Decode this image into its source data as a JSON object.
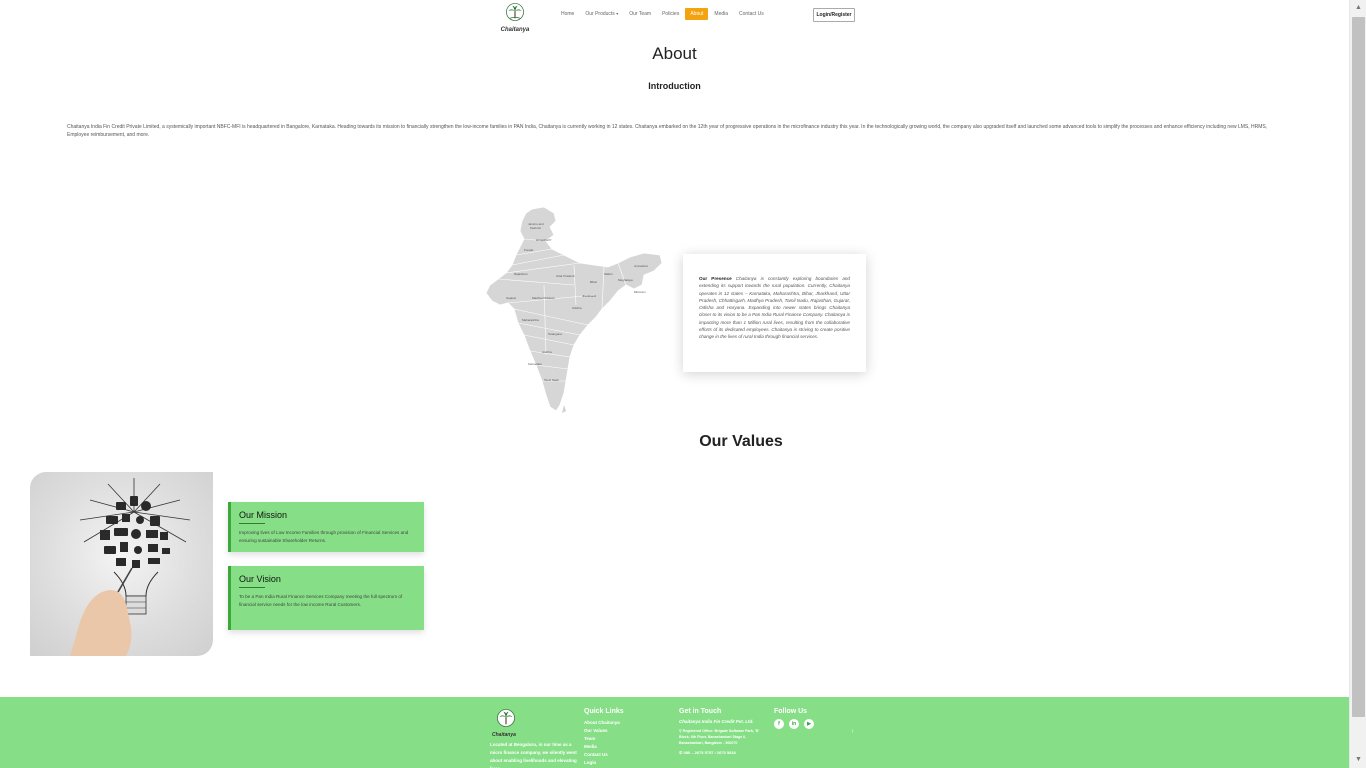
{
  "header": {
    "logo_text": "Chaitanya",
    "nav": [
      {
        "label": "Home"
      },
      {
        "label": "Our Products"
      },
      {
        "label": "Our Team"
      },
      {
        "label": "Policies"
      },
      {
        "label": "About"
      },
      {
        "label": "Media"
      },
      {
        "label": "Contact Us"
      }
    ],
    "active_nav": "About",
    "login_label": "Login/Register"
  },
  "about": {
    "title": "About",
    "intro_heading": "Introduction",
    "intro_text": "Chaitanya India Fin Credit Private Limited, a systemically important NBFC-MFI is headquartered in Bangalore, Karnataka. Heading towards its mission to financially strengthen the low-income families in PAN India, Chaitanya is currently working in 12 states. Chaitanya embarked on the 12th year of progressive operations in the microfinance industry this year. In the technologically growing world, the company also upgraded itself and launched some advanced tools to simplify the processes and enhance efficiency including new LMS, HRMS, Employee reimbursement, and more."
  },
  "presence": {
    "heading": "Our Presence",
    "text": "Chaitanya is constantly exploring boundaries and extending its support towards the rural population. Currently, Chaitanya operates in 12 states – Karnataka, Maharashtra, Bihar, Jharkhand, Uttar Pradesh, Chhattisgarh, Madhya Pradesh, Tamil Nadu, Rajasthan, Gujarat, Odisha and Haryana. Expanding into newer states brings Chaitanya closer to its vision to be a Pan India Rural Finance Company. Chaitanya is impacting more than 1 Million rural lives, resulting from the collaborative efforts of its dedicated employees. Chaitanya is striving to create positive change in the lives of rural India through financial services."
  },
  "values": {
    "title": "Our Values",
    "mission_title": "Our Mission",
    "mission_text": "Improving lives of Low Income Families through provision of Financial Services and ensuring sustainable Shareholder Returns.",
    "vision_title": "Our Vision",
    "vision_text": "To be a Pan India Rural Finance Services Company meeting the full spectrum of financial service needs for the low income Rural Customers."
  },
  "footer": {
    "logo_text": "Chaitanya",
    "about_text": "Located at Bengaluru, in our time as a micro finance company, we silently went about enabling livelihoods and elevating lives.",
    "quick_links_title": "Quick Links",
    "quick_links": [
      "About Chaitanya",
      "Our Values",
      "Team",
      "Media",
      "Contact Us",
      "Login"
    ],
    "get_in_touch_title": "Get in Touch",
    "company_name": "Chaitanya India Fin Credit Pvt. Ltd.",
    "address": "Registered Office: Brigade Software Park, 'B' Block, 6th Floor, Banashankari Stage II, Banashankari, Bangalore - 560070",
    "phone": "080 – 2675 5757 / 2675 5818",
    "follow_us_title": "Follow Us",
    "social_icons": [
      "facebook-icon",
      "linkedin-icon",
      "youtube-icon"
    ]
  }
}
